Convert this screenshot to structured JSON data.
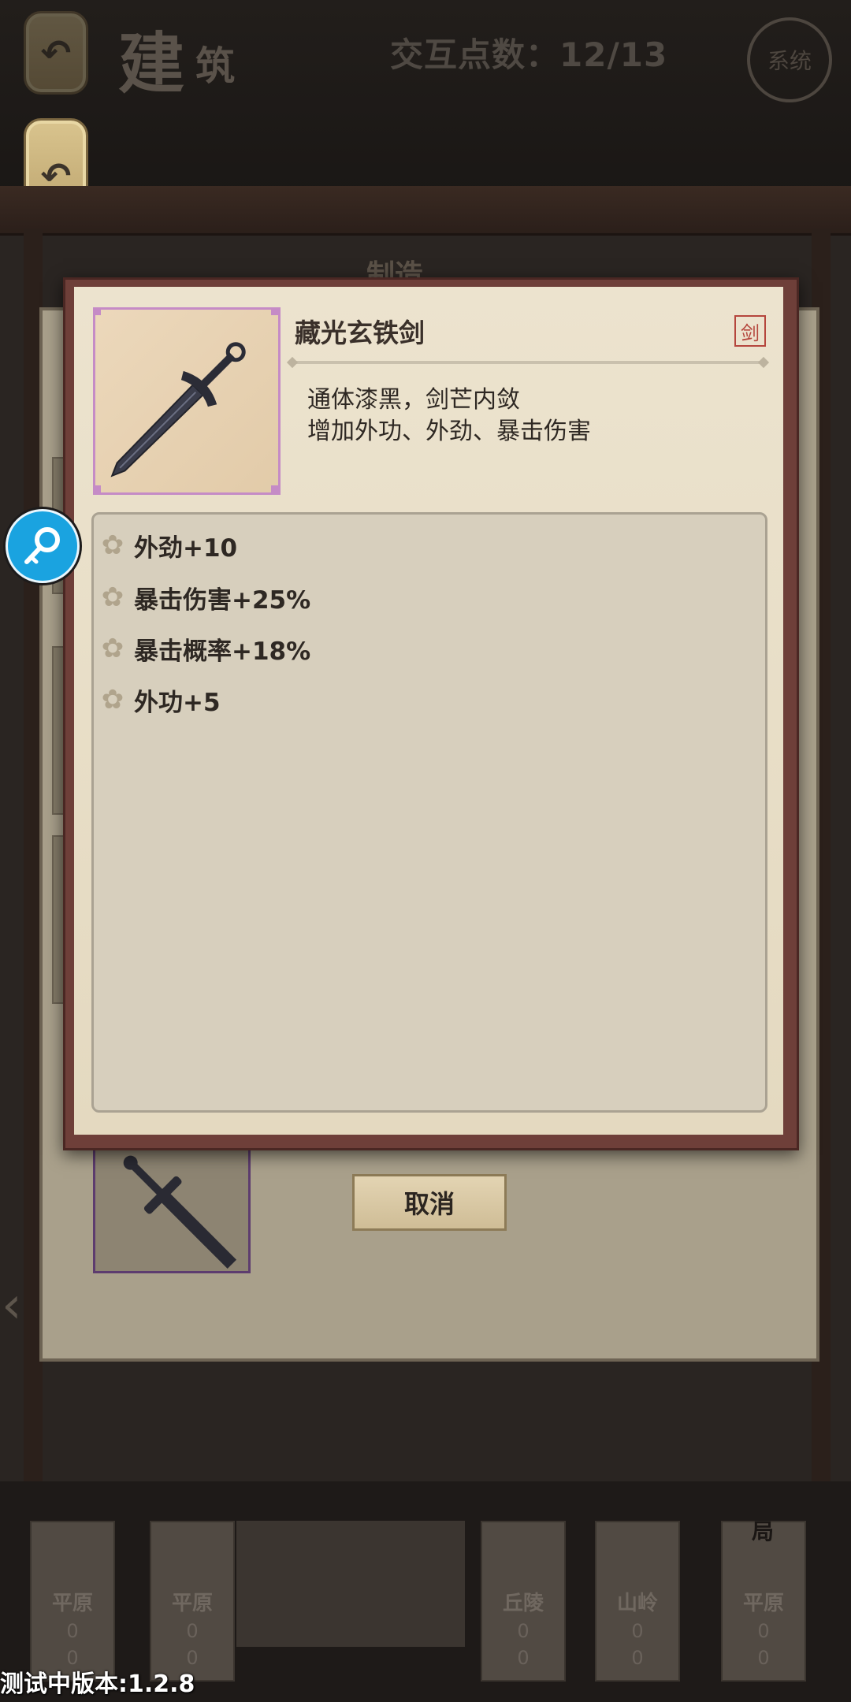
{
  "header": {
    "title_char_1": "建",
    "title_char_2": "筑",
    "counter": "交互点数：12/13",
    "system_label": "系统",
    "back_icon": "undo-arrow-icon"
  },
  "panel": {
    "tab_label": "制造"
  },
  "modal": {
    "item_name": "藏光玄铁剑",
    "type_badge": "剑",
    "description_line_1": "通体漆黑，剑芒内敛",
    "description_line_2": "增加外功、外劲、暴击伤害",
    "stats": [
      {
        "label": "外劲+10"
      },
      {
        "label": "暴击伤害+25%"
      },
      {
        "label": "暴击概率+18%"
      },
      {
        "label": "外功+5"
      }
    ]
  },
  "actions": {
    "cancel_label": "取消"
  },
  "terrain": [
    {
      "label": "平原",
      "count_top": "0",
      "count_bottom": "0"
    },
    {
      "label": "平原",
      "count_top": "0",
      "count_bottom": "0"
    },
    {
      "label": "丘陵",
      "count_top": "0",
      "count_bottom": "0"
    },
    {
      "label": "山岭",
      "count_top": "0",
      "count_bottom": "0"
    },
    {
      "label": "平原",
      "count_top": "0",
      "count_bottom": "0"
    }
  ],
  "bottom_right_label": "局",
  "version_text": "测试中版本:1.2.8",
  "colors": {
    "modal_frame": "#6e3f39",
    "parchment": "#ece3ce",
    "badge_red": "#b5463d",
    "search_blue": "#1aa3e0"
  }
}
